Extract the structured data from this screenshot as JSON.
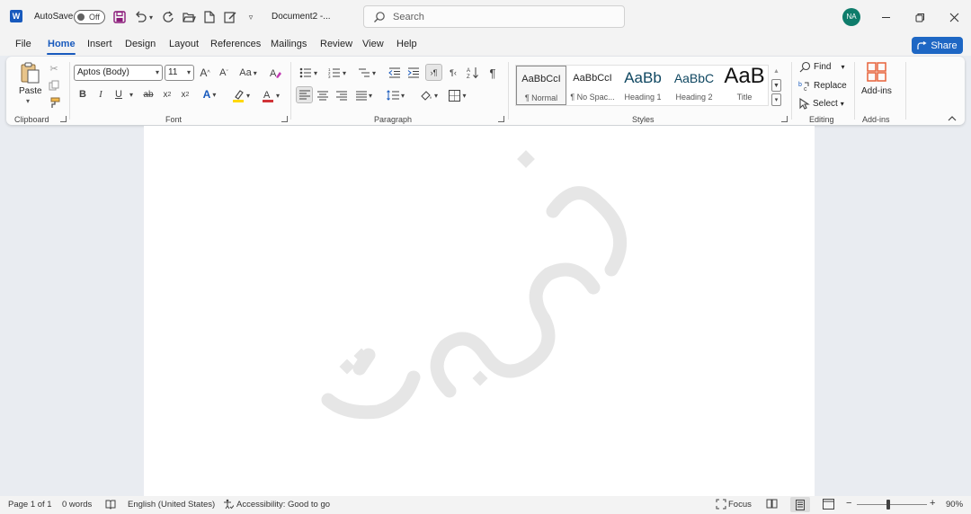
{
  "titlebar": {
    "app_icon": "word-logo-icon",
    "autosave_label": "AutoSave",
    "autosave_state": "Off",
    "doc_title": "Document2 -...",
    "search_placeholder": "Search",
    "user_initials": "NA"
  },
  "menu": {
    "tabs": [
      "File",
      "Home",
      "Insert",
      "Design",
      "Layout",
      "References",
      "Mailings",
      "Review",
      "View",
      "Help"
    ],
    "active": "Home",
    "share_label": "Share"
  },
  "ribbon": {
    "groups": {
      "clipboard": "Clipboard",
      "font": "Font",
      "paragraph": "Paragraph",
      "styles": "Styles",
      "editing": "Editing",
      "addins": "Add-ins"
    },
    "paste_label": "Paste",
    "font_name": "Aptos (Body)",
    "font_size": "11",
    "change_case": "Aa",
    "styles": [
      {
        "preview": "AaBbCcI",
        "name": "¶ Normal"
      },
      {
        "preview": "AaBbCcI",
        "name": "¶ No Spac..."
      },
      {
        "preview": "AaBb",
        "name": "Heading 1"
      },
      {
        "preview": "AaBbC",
        "name": "Heading 2"
      },
      {
        "preview": "AaB",
        "name": "Title"
      }
    ],
    "find_label": "Find",
    "replace_label": "Replace",
    "select_label": "Select",
    "addins_label": "Add-ins"
  },
  "status": {
    "page": "Page 1 of 1",
    "words": "0 words",
    "language": "English (United States)",
    "accessibility": "Accessibility: Good to go",
    "focus": "Focus",
    "zoom": "90%"
  },
  "colors": {
    "accent": "#185abd",
    "share": "#1e67c4",
    "highlight": "#ffd800",
    "font_color": "#d13438",
    "avatar": "#0e7c6b",
    "addins_icon": "#e8633b"
  }
}
